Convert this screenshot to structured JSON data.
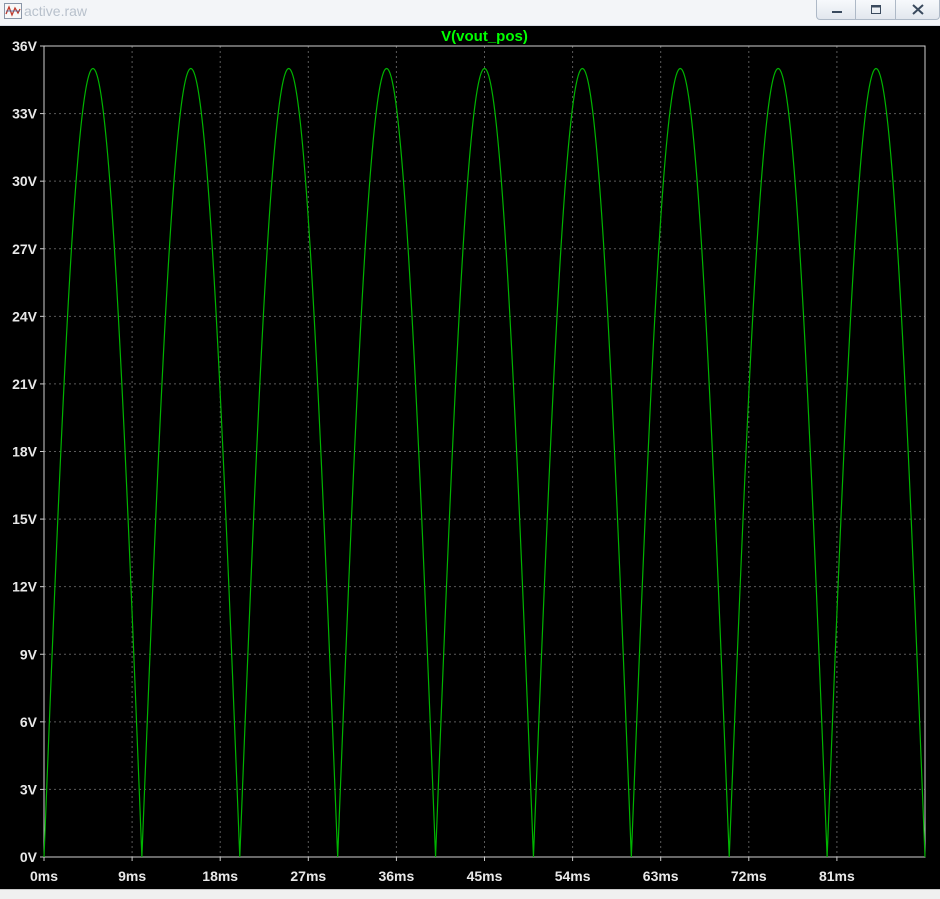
{
  "window": {
    "title": "active.raw"
  },
  "colors": {
    "background": "#000000",
    "trace": "#00b400",
    "title": "#00ff00",
    "grid": "#5a5a5a",
    "axis_text": "#e8e8e8"
  },
  "icons": {
    "app": "waveform-viewer-icon",
    "minimize": "minimize-icon",
    "maximize": "maximize-icon",
    "close": "close-icon"
  },
  "chart_data": {
    "type": "line",
    "title": "V(vout_pos)",
    "xlabel": "",
    "ylabel": "",
    "x_unit": "ms",
    "y_unit": "V",
    "xlim": [
      0,
      90
    ],
    "ylim": [
      0,
      36
    ],
    "grid": true,
    "x_ticks": [
      0,
      9,
      18,
      27,
      36,
      45,
      54,
      63,
      72,
      81
    ],
    "x_tick_labels": [
      "0ms",
      "9ms",
      "18ms",
      "27ms",
      "36ms",
      "45ms",
      "54ms",
      "63ms",
      "72ms",
      "81ms"
    ],
    "y_ticks": [
      0,
      3,
      6,
      9,
      12,
      15,
      18,
      21,
      24,
      27,
      30,
      33,
      36
    ],
    "y_tick_labels": [
      "0V",
      "3V",
      "6V",
      "9V",
      "12V",
      "15V",
      "18V",
      "21V",
      "24V",
      "27V",
      "30V",
      "33V",
      "36V"
    ],
    "series": [
      {
        "name": "V(vout_pos)",
        "peak": 35,
        "period_ms": 10,
        "x_ms": [
          0,
          0.5,
          1,
          1.5,
          2,
          2.5,
          3,
          3.5,
          4,
          4.5,
          5,
          5.5,
          6,
          6.5,
          7,
          7.5,
          8,
          8.5,
          9,
          9.5,
          10
        ],
        "y_v": [
          0,
          5.5,
          10.8,
          15.9,
          20.6,
          24.7,
          28.3,
          31.2,
          33.3,
          34.6,
          35,
          34.6,
          33.3,
          31.2,
          28.3,
          24.7,
          20.6,
          15.9,
          10.8,
          5.5,
          0
        ]
      }
    ]
  }
}
